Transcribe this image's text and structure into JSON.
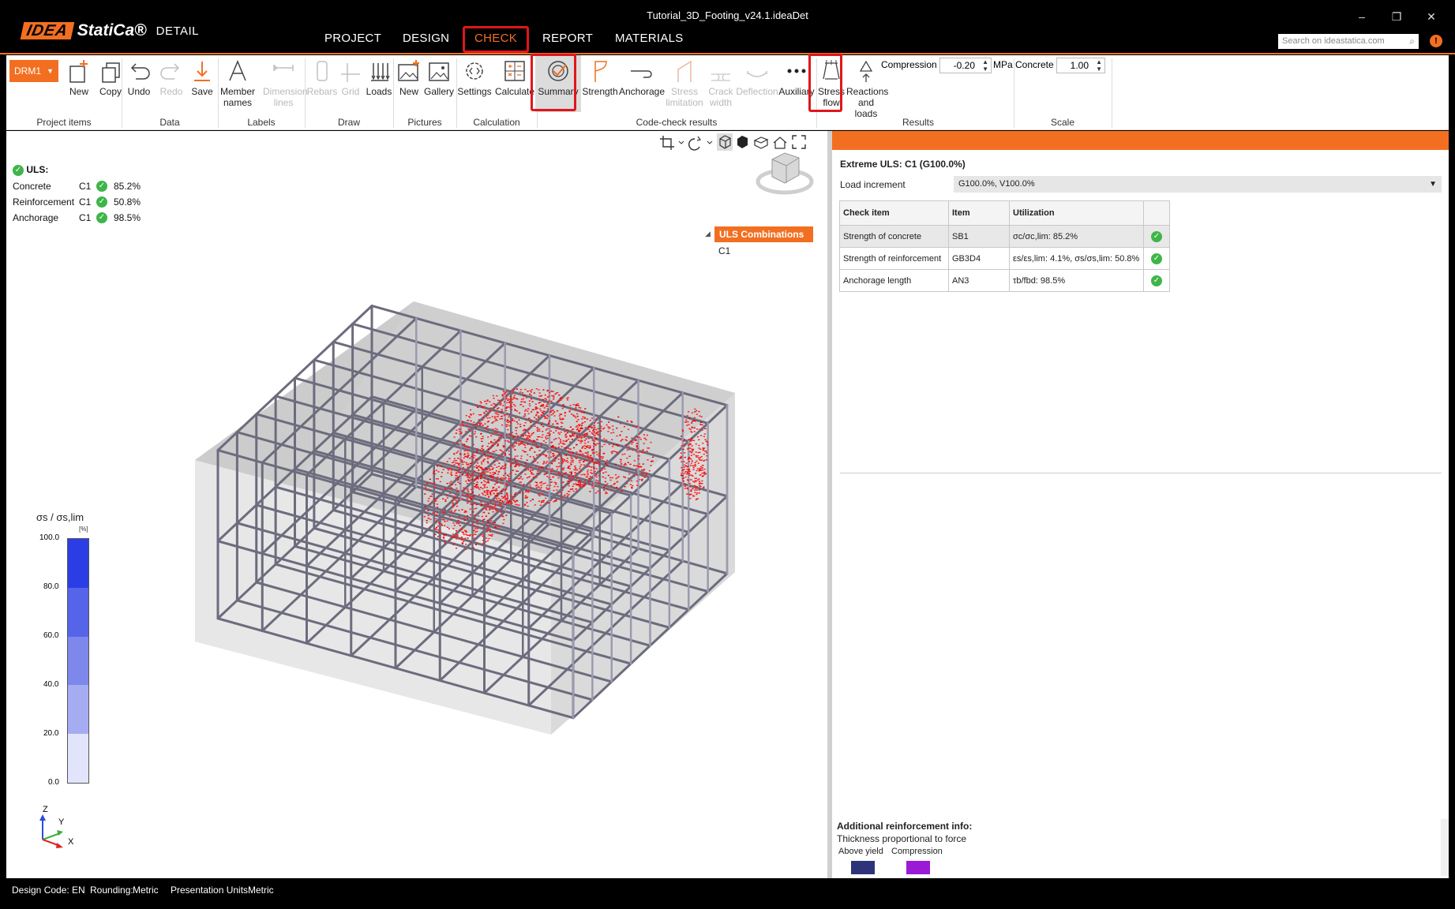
{
  "app": {
    "brand_box": "IDEA",
    "brand_name": "StatiCa®",
    "product": "DETAIL",
    "document_title": "Tutorial_3D_Footing_v24.1.ideaDet",
    "window_controls": [
      "–",
      "❐",
      "✕"
    ]
  },
  "menu": {
    "items": [
      "PROJECT",
      "DESIGN",
      "CHECK",
      "REPORT",
      "MATERIALS"
    ],
    "active": "CHECK"
  },
  "search": {
    "placeholder": "Search on ideastatica.com"
  },
  "ribbon": {
    "member_selector": "DRM1",
    "groups": {
      "project_items": {
        "label": "Project items",
        "buttons": [
          "New",
          "Copy"
        ]
      },
      "data": {
        "label": "Data",
        "buttons": [
          "Undo",
          "Redo",
          "Save"
        ]
      },
      "labels": {
        "label": "Labels",
        "buttons": [
          "Member names",
          "Dimension lines"
        ]
      },
      "draw": {
        "label": "Draw",
        "buttons": [
          "Rebars",
          "Grid",
          "Loads"
        ]
      },
      "pictures": {
        "label": "Pictures",
        "buttons": [
          "New",
          "Gallery"
        ]
      },
      "calculation": {
        "label": "Calculation",
        "buttons": [
          "Settings",
          "Calculate"
        ]
      },
      "code_check": {
        "label": "Code-check results",
        "buttons": [
          "Summary",
          "Strength",
          "Anchorage",
          "Stress limitation",
          "Crack width",
          "Deflection",
          "Auxiliary"
        ]
      },
      "results": {
        "label": "Results",
        "buttons": [
          "Stress flow",
          "Reactions and loads"
        ],
        "compression_label": "Compression",
        "compression_value": "-0.20",
        "compression_unit": "MPa"
      },
      "scale": {
        "label": "Scale",
        "concrete_label": "Concrete",
        "concrete_value": "1.00"
      }
    }
  },
  "viewport": {
    "uls_summary": {
      "title": "ULS:",
      "rows": [
        {
          "name": "Concrete",
          "combo": "C1",
          "value": "85.2%"
        },
        {
          "name": "Reinforcement",
          "combo": "C1",
          "value": "50.8%"
        },
        {
          "name": "Anchorage",
          "combo": "C1",
          "value": "98.5%"
        }
      ]
    },
    "tree": {
      "header": "ULS Combinations",
      "items": [
        "C1"
      ]
    },
    "legend": {
      "title": "σs / σs,lim",
      "unit": "[%]",
      "ticks": [
        "100.0",
        "80.0",
        "60.0",
        "40.0",
        "20.0",
        "0.0"
      ],
      "colors": [
        "#2b3ee6",
        "#5564e8",
        "#7d87ec",
        "#a6acf1",
        "#e2e4fb"
      ]
    },
    "axes": {
      "z": "Z",
      "y": "Y",
      "x": "X"
    }
  },
  "results_panel": {
    "title": "Extreme ULS: C1 (G100.0%)",
    "load_increment_label": "Load increment",
    "load_increment_value": "G100.0%, V100.0%",
    "table": {
      "headers": [
        "Check item",
        "Item",
        "Utilization",
        ""
      ],
      "rows": [
        {
          "check": "Strength of concrete",
          "item": "SB1",
          "utilization": "σc/σc,lim: 85.2%"
        },
        {
          "check": "Strength of reinforcement",
          "item": "GB3D4",
          "utilization": "εs/εs,lim: 4.1%, σs/σs,lim: 50.8%"
        },
        {
          "check": "Anchorage length",
          "item": "AN3",
          "utilization": "τb/fbd: 98.5%"
        }
      ]
    },
    "additional_info": {
      "title": "Additional reinforcement info:",
      "subtitle": "Thickness proportional to force",
      "above_yield": "Above yield",
      "compression": "Compression",
      "above_yield_color": "#2e3479",
      "compression_color": "#9b1ad6"
    }
  },
  "statusbar": {
    "design_code": "Design Code: EN",
    "rounding_label": "Rounding:",
    "rounding_value": "Metric",
    "units_label": "Presentation Units:",
    "units_value": "Metric"
  },
  "colors": {
    "accent": "#f26f21",
    "highlight": "#e0161b",
    "ok": "#3fb549"
  }
}
